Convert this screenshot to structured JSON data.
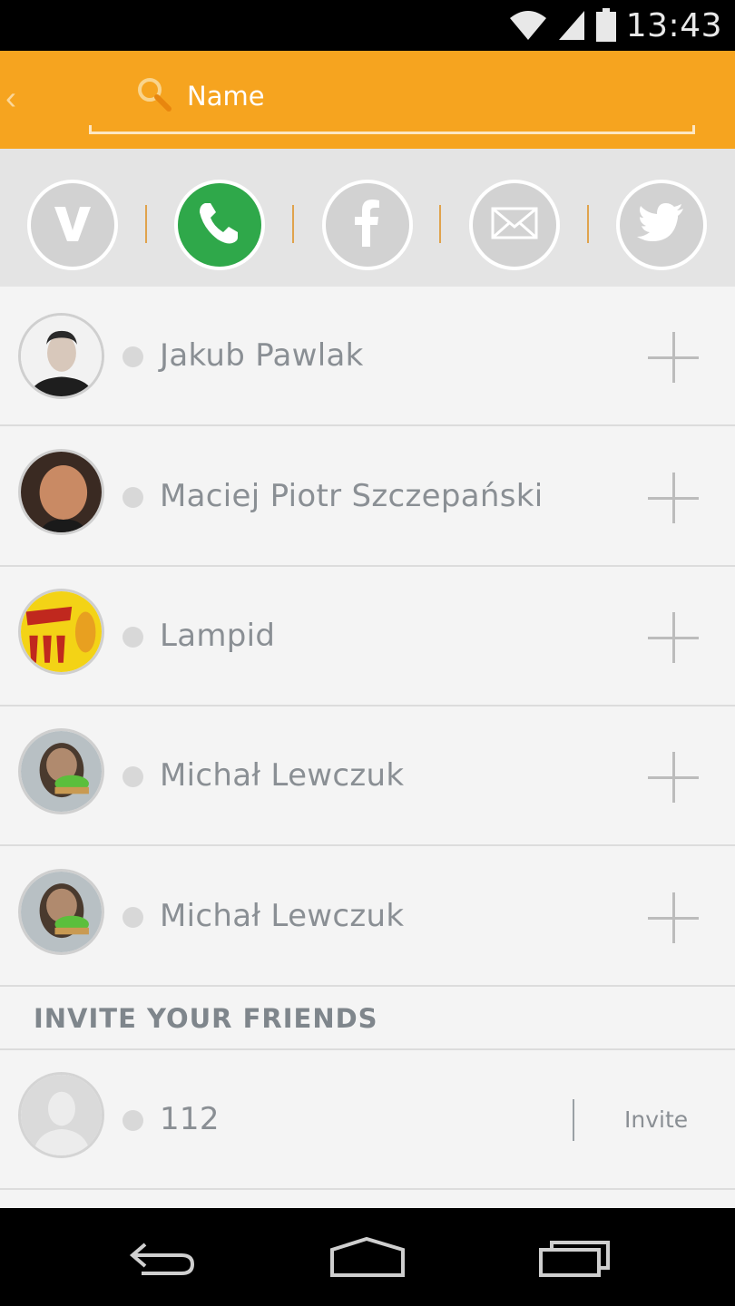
{
  "status_bar": {
    "time": "13:43",
    "icons": [
      "wifi-icon",
      "signal-icon",
      "battery-icon"
    ]
  },
  "search": {
    "placeholder": "Name",
    "back_icon": "back-chevron-icon",
    "search_icon": "search-icon"
  },
  "tabs": [
    {
      "name": "viber",
      "icon": "viber-icon",
      "active": false
    },
    {
      "name": "phone",
      "icon": "phone-icon",
      "active": true
    },
    {
      "name": "facebook",
      "icon": "facebook-icon",
      "active": false
    },
    {
      "name": "email",
      "icon": "email-icon",
      "active": false
    },
    {
      "name": "twitter",
      "icon": "twitter-icon",
      "active": false
    }
  ],
  "contacts": [
    {
      "name": "Jakub Pawlak",
      "action_icon": "add-icon"
    },
    {
      "name": "Maciej Piotr Szczepański",
      "action_icon": "add-icon"
    },
    {
      "name": "Lampid",
      "action_icon": "add-icon"
    },
    {
      "name": "Michał Lewczuk",
      "action_icon": "add-icon"
    },
    {
      "name": "Michał Lewczuk",
      "action_icon": "add-icon"
    }
  ],
  "invite_section": {
    "title": "INVITE YOUR FRIENDS",
    "items": [
      {
        "name": "112",
        "action_label": "Invite"
      }
    ]
  },
  "nav_bar": {
    "icons": [
      "back-icon",
      "home-icon",
      "recents-icon"
    ]
  },
  "colors": {
    "accent": "#f6a41f",
    "tab_active": "#2fa84a",
    "tab_inactive": "#d2d2d2",
    "text": "#8a8f94"
  }
}
